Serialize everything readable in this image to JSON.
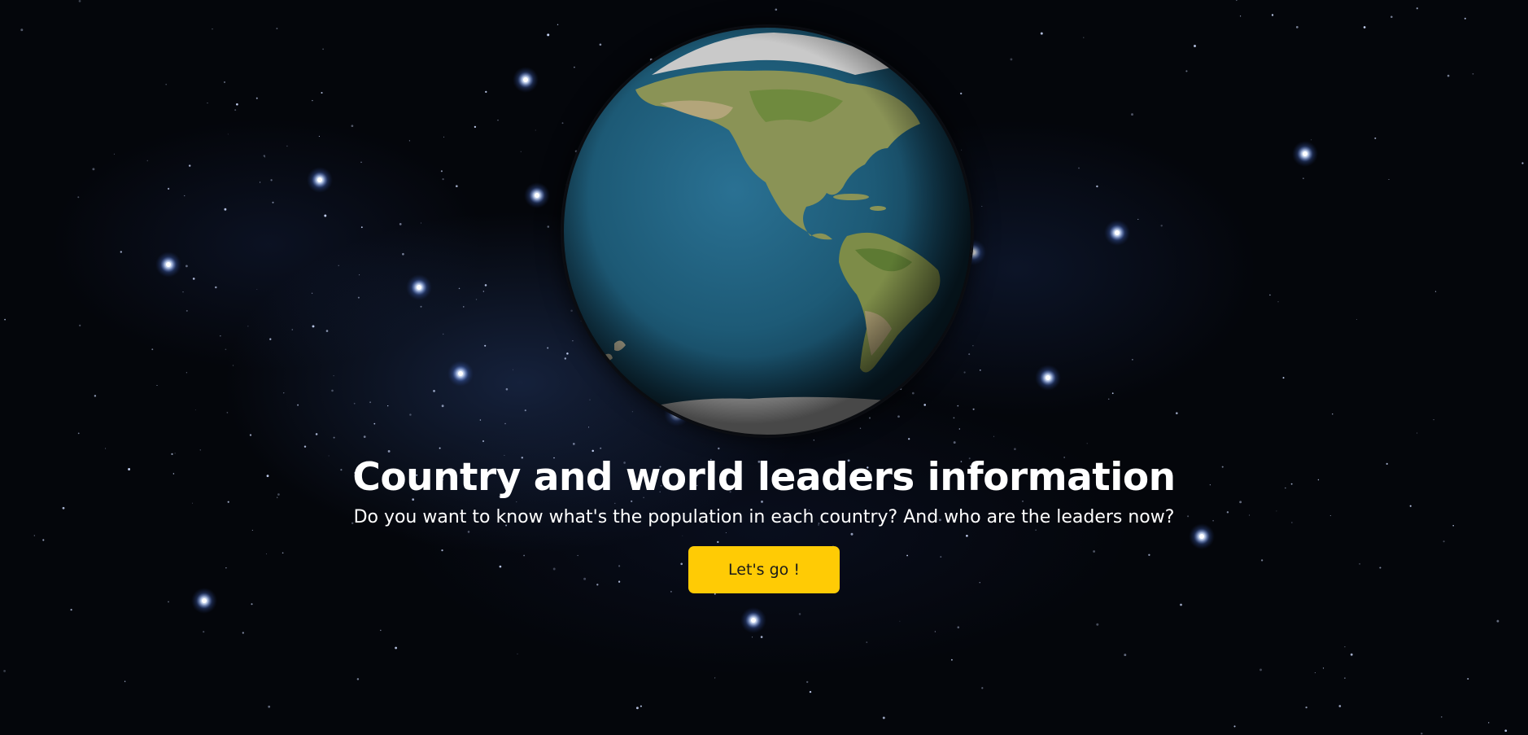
{
  "hero": {
    "title": "Country and world leaders information",
    "subtitle": "Do you want to know what's the population in each country? And who are the leaders now?",
    "cta_label": "Let's go !"
  },
  "colors": {
    "background": "#04060b",
    "accent": "#ffcb05",
    "ocean": "#1e5a78",
    "land": "#7a8a4a",
    "ice": "#c8c8c8"
  },
  "icons": {
    "globe": "globe-icon"
  }
}
